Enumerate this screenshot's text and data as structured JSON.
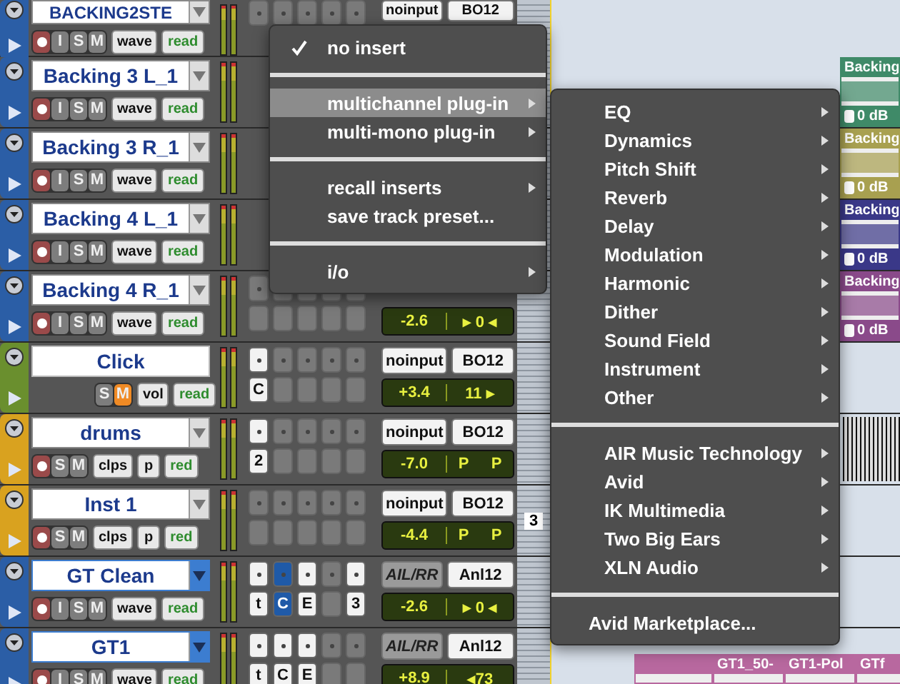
{
  "tracks": [
    {
      "name": "BACKING2STE",
      "color": "#2b5ea6",
      "name_menu": true,
      "selected": false,
      "record": true,
      "buttons": [
        {
          "label": "I",
          "on": false
        },
        {
          "label": "S",
          "on": false
        },
        {
          "label": "M",
          "on": false
        }
      ],
      "view": "wave",
      "automation": "read",
      "inserts": [
        {
          "kind": "empty"
        },
        {
          "kind": "empty"
        },
        {
          "kind": "empty"
        },
        {
          "kind": "empty"
        },
        {
          "kind": "empty"
        }
      ],
      "input": {
        "label": "noinput",
        "kind": "plain"
      },
      "output": "BO12",
      "lane": {
        "kind": "empty"
      }
    },
    {
      "name": "Backing 3 L_1",
      "color": "#2b5ea6",
      "name_menu": true,
      "selected": false,
      "record": true,
      "buttons": [
        {
          "label": "I",
          "on": false
        },
        {
          "label": "S",
          "on": false
        },
        {
          "label": "M",
          "on": false
        }
      ],
      "view": "wave",
      "automation": "read",
      "lane": {
        "kind": "edge",
        "clips": [
          {
            "name": "Backing",
            "gain": "0 dB",
            "color": "#3f8a68"
          }
        ]
      }
    },
    {
      "name": "Backing 3 R_1",
      "color": "#2b5ea6",
      "name_menu": true,
      "selected": false,
      "record": true,
      "buttons": [
        {
          "label": "I",
          "on": false
        },
        {
          "label": "S",
          "on": false
        },
        {
          "label": "M",
          "on": false
        }
      ],
      "view": "wave",
      "automation": "read",
      "lane": {
        "kind": "edge",
        "clips": [
          {
            "name": "Backing",
            "gain": "0 dB",
            "color": "#a8a050"
          }
        ]
      }
    },
    {
      "name": "Backing 4 L_1",
      "color": "#2b5ea6",
      "name_menu": true,
      "selected": false,
      "record": true,
      "buttons": [
        {
          "label": "I",
          "on": false
        },
        {
          "label": "S",
          "on": false
        },
        {
          "label": "M",
          "on": false
        }
      ],
      "view": "wave",
      "automation": "read",
      "lane": {
        "kind": "edge",
        "clips": [
          {
            "name": "Backing",
            "gain": "0 dB",
            "color": "#3a3888"
          }
        ]
      }
    },
    {
      "name": "Backing 4 R_1",
      "color": "#2b5ea6",
      "name_menu": true,
      "selected": false,
      "record": true,
      "buttons": [
        {
          "label": "I",
          "on": false
        },
        {
          "label": "S",
          "on": false
        },
        {
          "label": "M",
          "on": false
        }
      ],
      "view": "wave",
      "automation": "read",
      "inserts": [
        {
          "kind": "empty"
        },
        {
          "kind": "empty"
        },
        {
          "kind": "empty"
        },
        {
          "kind": "empty"
        },
        {
          "kind": "empty"
        }
      ],
      "sends": [
        {
          "kind": "empty"
        },
        {
          "kind": "empty"
        },
        {
          "kind": "empty"
        },
        {
          "kind": "empty"
        },
        {
          "kind": "empty"
        }
      ],
      "volume": "-2.6",
      "pan": [
        "▸ 0 ◂"
      ],
      "lane": {
        "kind": "edge",
        "clips": [
          {
            "name": "Backing",
            "gain": "0 dB",
            "color": "#8a4a8a"
          }
        ]
      }
    },
    {
      "name": "Click",
      "color": "#6a8f2e",
      "name_menu": false,
      "selected": false,
      "record": false,
      "buttons": [
        {
          "label": "S",
          "on": false
        },
        {
          "label": "M",
          "on": true
        }
      ],
      "view": "vol",
      "automation": "read",
      "inserts": [
        {
          "kind": "filled"
        },
        {
          "kind": "empty"
        },
        {
          "kind": "empty"
        },
        {
          "kind": "empty"
        },
        {
          "kind": "empty"
        }
      ],
      "sends": [
        {
          "kind": "filled",
          "label": "C"
        },
        {
          "kind": "empty"
        },
        {
          "kind": "empty"
        },
        {
          "kind": "empty"
        },
        {
          "kind": "empty"
        }
      ],
      "input": {
        "label": "noinput",
        "kind": "plain"
      },
      "output": "BO12",
      "volume": "+3.4",
      "pan": [
        "11 ▸"
      ],
      "lane": {
        "kind": "empty"
      }
    },
    {
      "name": "drums",
      "color": "#d9a21f",
      "name_menu": true,
      "selected": false,
      "record": true,
      "buttons": [
        {
          "label": "S",
          "on": false
        },
        {
          "label": "M",
          "on": false
        }
      ],
      "view": "clps",
      "extra": "p",
      "automation": "red",
      "inserts": [
        {
          "kind": "filled"
        },
        {
          "kind": "empty"
        },
        {
          "kind": "empty"
        },
        {
          "kind": "empty"
        },
        {
          "kind": "empty"
        }
      ],
      "sends": [
        {
          "kind": "filled",
          "label": "2"
        },
        {
          "kind": "empty"
        },
        {
          "kind": "empty"
        },
        {
          "kind": "empty"
        },
        {
          "kind": "empty"
        }
      ],
      "input": {
        "label": "noinput",
        "kind": "plain"
      },
      "output": "BO12",
      "volume": "-7.0",
      "pan": [
        "P",
        "P"
      ],
      "lane": {
        "kind": "waveform"
      }
    },
    {
      "name": "Inst 1",
      "color": "#d9a21f",
      "name_menu": true,
      "selected": false,
      "record": true,
      "buttons": [
        {
          "label": "S",
          "on": false
        },
        {
          "label": "M",
          "on": false
        }
      ],
      "view": "clps",
      "extra": "p",
      "automation": "red",
      "inserts": [
        {
          "kind": "empty"
        },
        {
          "kind": "empty"
        },
        {
          "kind": "empty"
        },
        {
          "kind": "empty"
        },
        {
          "kind": "empty"
        }
      ],
      "sends": [
        {
          "kind": "empty"
        },
        {
          "kind": "empty"
        },
        {
          "kind": "empty"
        },
        {
          "kind": "empty"
        },
        {
          "kind": "empty"
        }
      ],
      "input": {
        "label": "noinput",
        "kind": "plain"
      },
      "output": "BO12",
      "volume": "-4.4",
      "pan": [
        "P",
        "P"
      ],
      "ruler_label": "3",
      "lane": {
        "kind": "empty"
      }
    },
    {
      "name": "GT Clean",
      "color": "#2b5ea6",
      "name_menu": true,
      "selected": true,
      "record": true,
      "buttons": [
        {
          "label": "I",
          "on": false
        },
        {
          "label": "S",
          "on": false
        },
        {
          "label": "M",
          "on": false
        }
      ],
      "view": "wave",
      "automation": "read",
      "inserts": [
        {
          "kind": "filled"
        },
        {
          "kind": "active"
        },
        {
          "kind": "filled"
        },
        {
          "kind": "empty"
        },
        {
          "kind": "filled"
        }
      ],
      "sends": [
        {
          "kind": "filled",
          "label": "t"
        },
        {
          "kind": "active",
          "label": "C"
        },
        {
          "kind": "filled",
          "label": "E"
        },
        {
          "kind": "empty"
        },
        {
          "kind": "filled",
          "label": "3"
        }
      ],
      "input": {
        "label": "AIL/RR",
        "kind": "inactive"
      },
      "output": "Anl12",
      "volume": "-2.6",
      "pan": [
        "▸ 0 ◂"
      ],
      "lane": {
        "kind": "empty"
      }
    },
    {
      "name": "GT1",
      "color": "#2b5ea6",
      "name_menu": true,
      "selected": true,
      "record": true,
      "buttons": [
        {
          "label": "I",
          "on": false
        },
        {
          "label": "S",
          "on": false
        },
        {
          "label": "M",
          "on": false
        }
      ],
      "view": "wave",
      "automation": "read",
      "inserts": [
        {
          "kind": "filled"
        },
        {
          "kind": "filled"
        },
        {
          "kind": "filled"
        },
        {
          "kind": "empty"
        },
        {
          "kind": "empty"
        }
      ],
      "sends": [
        {
          "kind": "filled",
          "label": "t"
        },
        {
          "kind": "filled",
          "label": "C"
        },
        {
          "kind": "filled",
          "label": "E"
        },
        {
          "kind": "empty"
        },
        {
          "kind": "empty"
        }
      ],
      "input": {
        "label": "AIL/RR",
        "kind": "inactive"
      },
      "output": "Anl12",
      "volume": "+8.9",
      "pan": [
        "◂73"
      ],
      "lane": {
        "kind": "strip",
        "clips": [
          {
            "color": "#b8689f"
          },
          {
            "name": "GT1_50-",
            "color": "#b8689f"
          },
          {
            "name": "GT1-Pol",
            "color": "#b8689f"
          },
          {
            "name": "GTf",
            "color": "#b8689f"
          }
        ]
      }
    }
  ],
  "menus": [
    {
      "items": [
        {
          "kind": "item",
          "label": "no insert",
          "checked": true,
          "submenu": false,
          "selected": false
        },
        {
          "kind": "separator"
        },
        {
          "kind": "item",
          "label": "multichannel plug-in",
          "checked": false,
          "submenu": true,
          "selected": true
        },
        {
          "kind": "item",
          "label": "multi-mono plug-in",
          "checked": false,
          "submenu": true,
          "selected": false
        },
        {
          "kind": "separator"
        },
        {
          "kind": "item",
          "label": "recall inserts",
          "checked": false,
          "submenu": true,
          "selected": false
        },
        {
          "kind": "item",
          "label": "save track preset...",
          "checked": false,
          "submenu": false,
          "selected": false
        },
        {
          "kind": "separator"
        },
        {
          "kind": "item",
          "label": "i/o",
          "checked": false,
          "submenu": true,
          "selected": false
        }
      ]
    },
    {
      "items": [
        {
          "kind": "item",
          "label": "EQ",
          "checked": false,
          "submenu": true,
          "selected": false
        },
        {
          "kind": "item",
          "label": "Dynamics",
          "checked": false,
          "submenu": true,
          "selected": false
        },
        {
          "kind": "item",
          "label": "Pitch Shift",
          "checked": false,
          "submenu": true,
          "selected": false
        },
        {
          "kind": "item",
          "label": "Reverb",
          "checked": false,
          "submenu": true,
          "selected": false
        },
        {
          "kind": "item",
          "label": "Delay",
          "checked": false,
          "submenu": true,
          "selected": false
        },
        {
          "kind": "item",
          "label": "Modulation",
          "checked": false,
          "submenu": true,
          "selected": false
        },
        {
          "kind": "item",
          "label": "Harmonic",
          "checked": false,
          "submenu": true,
          "selected": false
        },
        {
          "kind": "item",
          "label": "Dither",
          "checked": false,
          "submenu": true,
          "selected": false
        },
        {
          "kind": "item",
          "label": "Sound Field",
          "checked": false,
          "submenu": true,
          "selected": false
        },
        {
          "kind": "item",
          "label": "Instrument",
          "checked": false,
          "submenu": true,
          "selected": false
        },
        {
          "kind": "item",
          "label": "Other",
          "checked": false,
          "submenu": true,
          "selected": false
        },
        {
          "kind": "separator"
        },
        {
          "kind": "item",
          "label": "AIR Music Technology",
          "checked": false,
          "submenu": true,
          "selected": false
        },
        {
          "kind": "item",
          "label": "Avid",
          "checked": false,
          "submenu": true,
          "selected": false
        },
        {
          "kind": "item",
          "label": "IK Multimedia",
          "checked": false,
          "submenu": true,
          "selected": false
        },
        {
          "kind": "item",
          "label": "Two Big Ears",
          "checked": false,
          "submenu": true,
          "selected": false
        },
        {
          "kind": "item",
          "label": "XLN Audio",
          "checked": false,
          "submenu": true,
          "selected": false
        },
        {
          "kind": "separator"
        },
        {
          "kind": "footer",
          "label": "Avid Marketplace...",
          "checked": false,
          "submenu": false,
          "selected": false
        }
      ]
    }
  ]
}
